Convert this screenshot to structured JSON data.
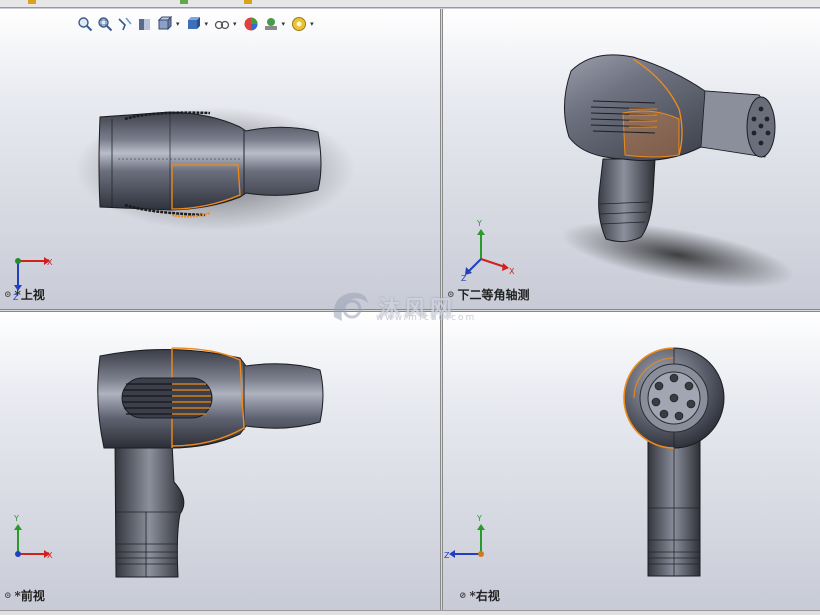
{
  "app": {
    "accent": "#f08a1a",
    "body_color": "#5a5e6b"
  },
  "toolbar": {
    "icons": [
      "zoom-to-fit-icon",
      "zoom-to-area-icon",
      "previous-view-icon",
      "section-view-icon",
      "view-orientation-icon",
      "display-style-icon",
      "hide-show-items-icon",
      "edit-appearance-icon",
      "apply-scene-icon",
      "view-settings-icon"
    ]
  },
  "views": {
    "top": {
      "label": "*上视",
      "axes": [
        "X",
        "Z"
      ]
    },
    "iso": {
      "label": "下二等角轴测",
      "axes": [
        "Y",
        "X",
        "Z"
      ]
    },
    "front": {
      "label": "*前视",
      "axes": [
        "Y",
        "X"
      ]
    },
    "right": {
      "label": "*右视",
      "axes": [
        "Y",
        "Z"
      ]
    }
  },
  "watermark": {
    "text": "沐风网",
    "url": "www.mfcad.com"
  }
}
